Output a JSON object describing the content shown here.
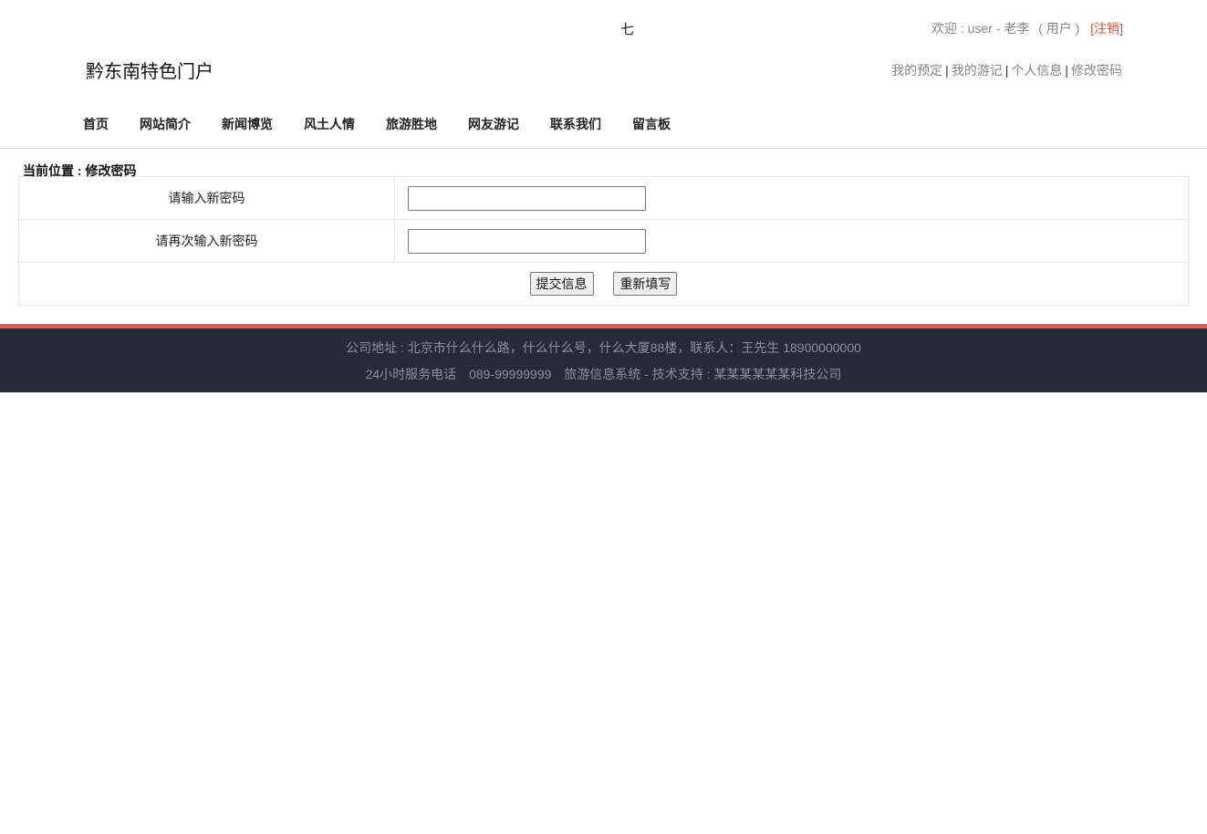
{
  "header": {
    "top_glyph": "七",
    "welcome_text": "欢迎 : user - 老李",
    "role_text": "( 用户 )",
    "logout_label": "[注销]",
    "site_title": "黔东南特色门户",
    "user_links": [
      "我的预定",
      "我的游记",
      "个人信息",
      "修改密码"
    ],
    "link_separator": "|"
  },
  "nav": {
    "items": [
      "首页",
      "网站简介",
      "新闻博览",
      "风土人情",
      "旅游胜地",
      "网友游记",
      "联系我们",
      "留言板"
    ]
  },
  "breadcrumb": "当前位置 : 修改密码",
  "form": {
    "new_password_label": "请输入新密码",
    "new_password_value": "",
    "confirm_password_label": "请再次输入新密码",
    "confirm_password_value": "",
    "submit_label": "提交信息",
    "reset_label": "重新填写"
  },
  "footer": {
    "address": "公司地址 : 北京市什么什么路，什么什么号，什么大厦88楼，联系人：王先生 18900000000",
    "hotline_label": "24小时服务电话",
    "hotline_number": "089-99999999",
    "system_info": "旅游信息系统 - 技术支持 : 某某某某某某科技公司"
  },
  "colors": {
    "footer_bg": "#252c37",
    "footer_accent": "#e8594b",
    "logout_color": "#e0523d"
  }
}
